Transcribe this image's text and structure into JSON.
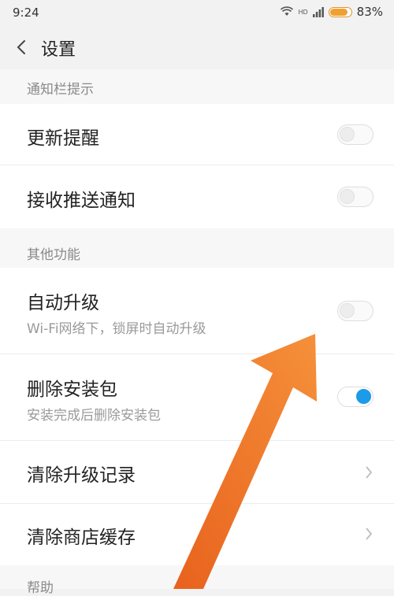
{
  "status": {
    "time": "9:24",
    "battery": "83%",
    "hd": "HD"
  },
  "header": {
    "title": "设置"
  },
  "sections": {
    "notify": {
      "title": "通知栏提示"
    },
    "other": {
      "title": "其他功能"
    },
    "help": {
      "title": "帮助"
    }
  },
  "rows": {
    "update_reminder": {
      "label": "更新提醒",
      "enabled": false
    },
    "push_notification": {
      "label": "接收推送通知",
      "enabled": false
    },
    "auto_upgrade": {
      "label": "自动升级",
      "sub": "Wi-Fi网络下，锁屏时自动升级",
      "enabled": false
    },
    "delete_package": {
      "label": "删除安装包",
      "sub": "安装完成后删除安装包",
      "enabled": true
    },
    "clear_upgrade": {
      "label": "清除升级记录"
    },
    "clear_cache": {
      "label": "清除商店缓存"
    }
  },
  "colors": {
    "accent": "#1e9be8",
    "annotation_arrow": "#f07a2a",
    "battery": "#f0a030"
  }
}
